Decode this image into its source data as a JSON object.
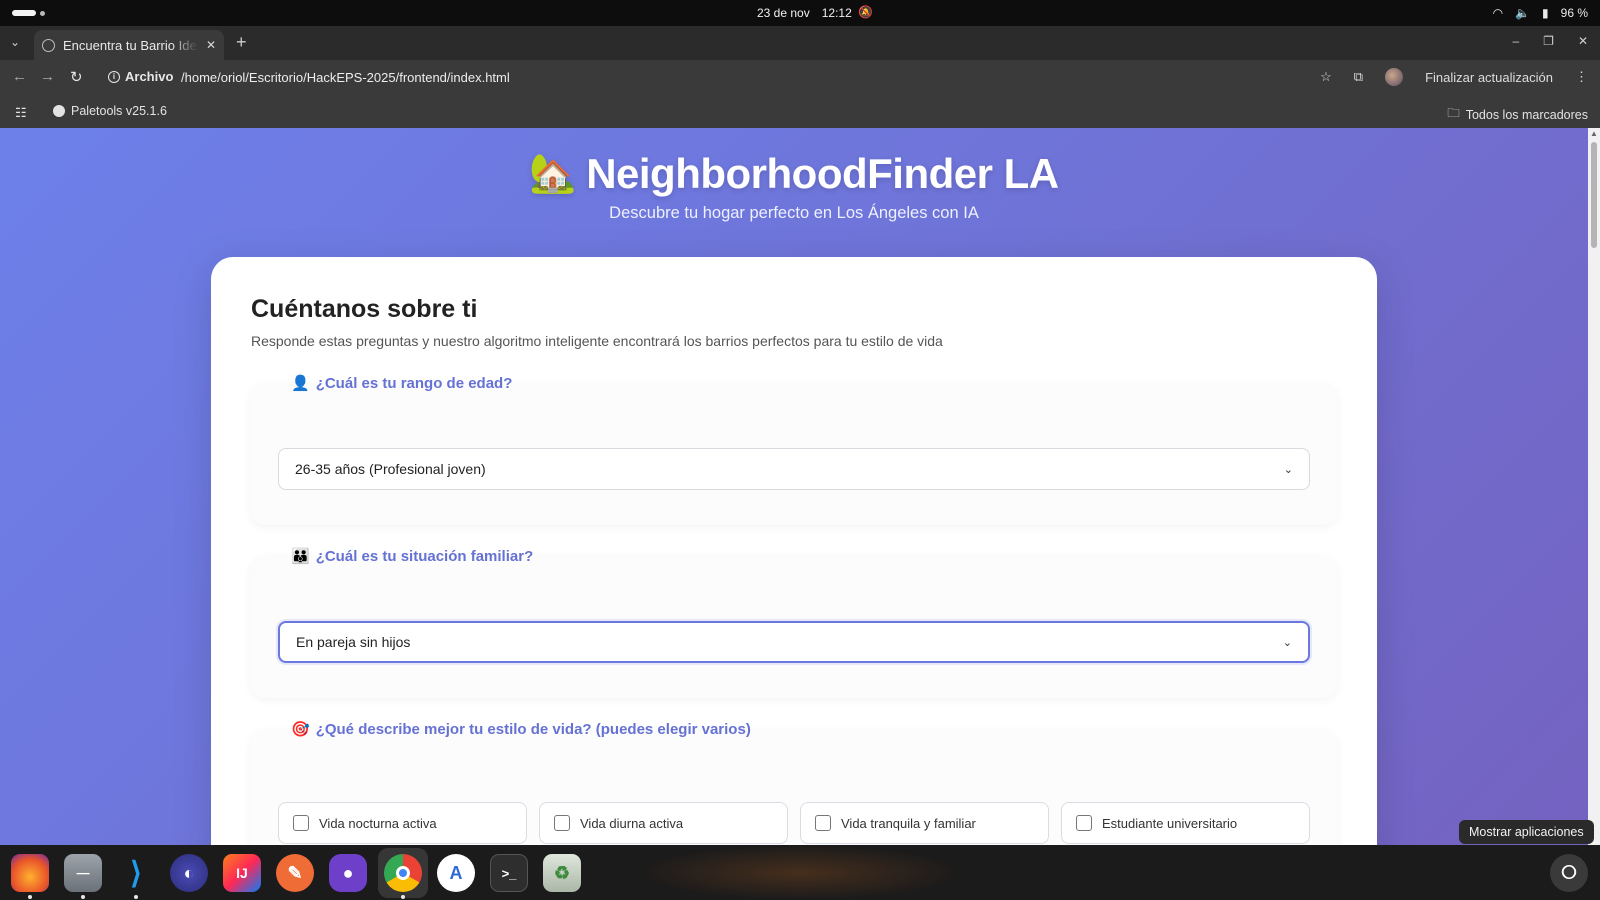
{
  "system_bar": {
    "date": "23 de nov",
    "time": "12:12",
    "battery": "96 %"
  },
  "browser": {
    "tab_title": "Encuentra tu Barrio Ideal",
    "scheme_label": "Archivo",
    "url": "/home/oriol/Escritorio/HackEPS-2025/frontend/index.html",
    "update_button": "Finalizar actualización",
    "bookmark_item": "Paletools v25.1.6",
    "all_bookmarks": "Todos los marcadores"
  },
  "hero": {
    "icon": "house-emoji",
    "title": "NeighborhoodFinder LA",
    "subtitle": "Descubre tu hogar perfecto en Los Ángeles con IA"
  },
  "form": {
    "title": "Cuéntanos sobre ti",
    "subtitle": "Responde estas preguntas y nuestro algoritmo inteligente encontrará los barrios perfectos para tu estilo de vida",
    "age": {
      "label": "¿Cuál es tu rango de edad?",
      "icon": "person-emoji",
      "selected": "26-35 años (Profesional joven)"
    },
    "family": {
      "label": "¿Cuál es tu situación familiar?",
      "icon": "family-emoji",
      "selected": "En pareja sin hijos"
    },
    "lifestyle": {
      "label": "¿Qué describe mejor tu estilo de vida? (puedes elegir varios)",
      "icon": "target-emoji",
      "options": [
        {
          "label": "Vida nocturna activa",
          "checked": false
        },
        {
          "label": "Vida diurna activa",
          "checked": false
        },
        {
          "label": "Vida tranquila y familiar",
          "checked": false
        },
        {
          "label": "Estudiante universitario",
          "checked": false
        }
      ]
    }
  },
  "dock": {
    "tooltip": "Mostrar aplicaciones",
    "apps": [
      "firefox",
      "files",
      "vscode",
      "eclipse",
      "intellij",
      "postman",
      "github-desktop",
      "chrome",
      "app-center",
      "terminal",
      "trash"
    ]
  },
  "colors": {
    "accent": "#6572d4",
    "page_gradient_start": "#6d80ea",
    "page_gradient_end": "#7462c0"
  }
}
